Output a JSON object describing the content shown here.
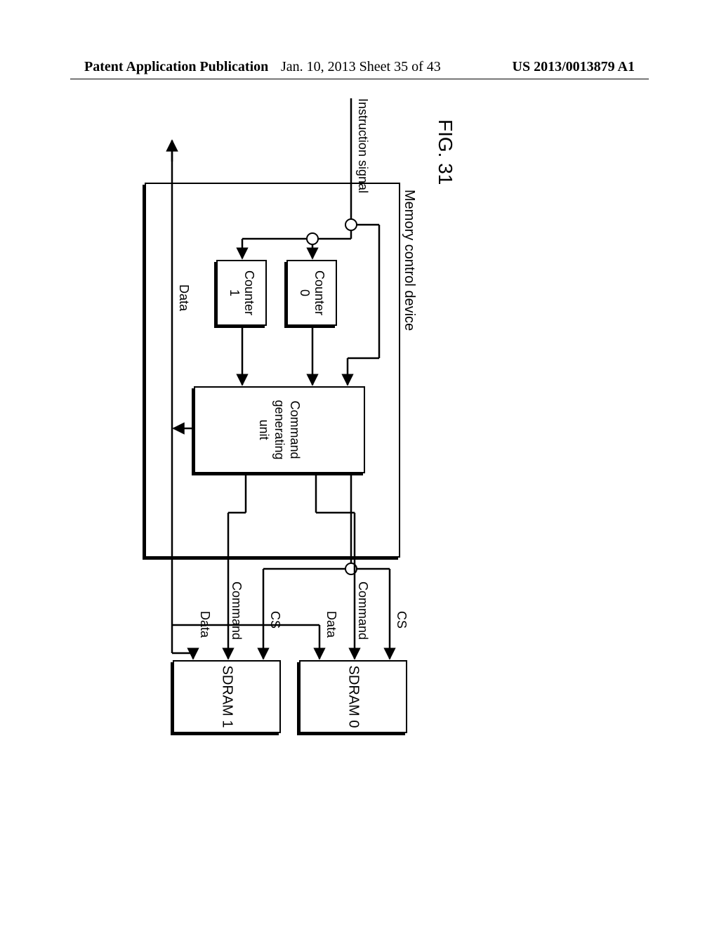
{
  "header": {
    "left": "Patent Application Publication",
    "center": "Jan. 10, 2013  Sheet 35 of 43",
    "right": "US 2013/0013879 A1"
  },
  "figure": {
    "label": "FIG. 31",
    "mem_ctrl_label": "Memory control device",
    "instruction_signal": "Instruction signal",
    "counter0": "Counter\n0",
    "counter1": "Counter\n1",
    "cmd_gen": "Command\ngenerating\nunit",
    "sdram0": "SDRAM 0",
    "sdram1": "SDRAM 1",
    "cs": "CS",
    "command": "Command",
    "data": "Data"
  }
}
